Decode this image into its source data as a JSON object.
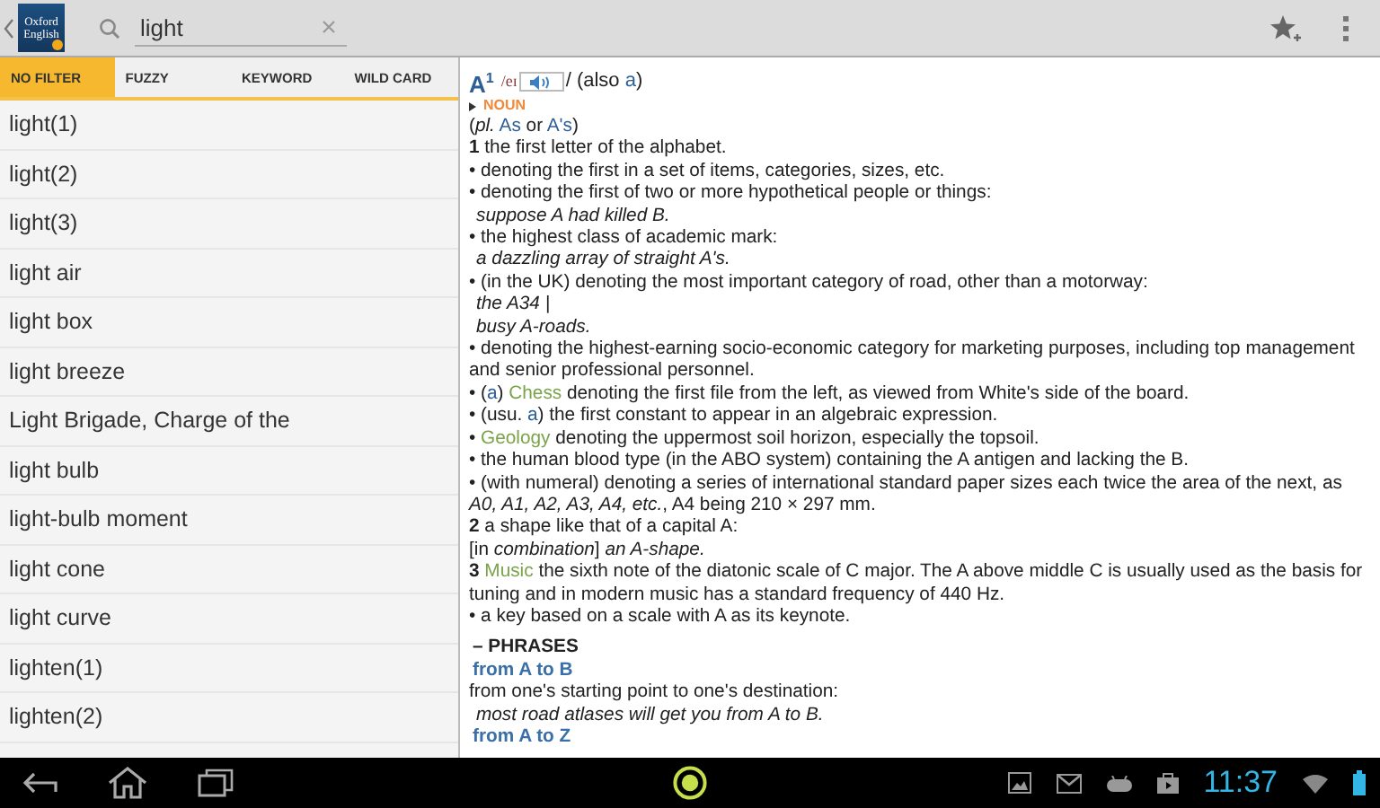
{
  "app_logo": {
    "lines": [
      "Oxford",
      "English"
    ]
  },
  "search": {
    "value": "light"
  },
  "filters": [
    {
      "label": "NO FILTER",
      "selected": true
    },
    {
      "label": "FUZZY",
      "selected": false
    },
    {
      "label": "KEYWORD",
      "selected": false
    },
    {
      "label": "WILD CARD",
      "selected": false
    }
  ],
  "results": [
    {
      "label": "light(1)"
    },
    {
      "label": "light(2)"
    },
    {
      "label": "light(3)"
    },
    {
      "label": "light air"
    },
    {
      "label": "light box"
    },
    {
      "label": "light breeze"
    },
    {
      "label": "Light Brigade, Charge of the"
    },
    {
      "label": "light bulb"
    },
    {
      "label": "light-bulb moment"
    },
    {
      "label": "light cone"
    },
    {
      "label": "light curve"
    },
    {
      "label": "lighten(1)"
    },
    {
      "label": "lighten(2)"
    }
  ],
  "entry": {
    "headword": "A",
    "homograph": "1",
    "pron_before": "/eɪ",
    "pron_after": "/ (also",
    "also": "a",
    "after_also": ")",
    "pos": "NOUN",
    "lines": [
      {
        "kind": "sense",
        "parts": [
          {
            "text": "(*pl.* ",
            "kind": "plain"
          },
          {
            "text": "As",
            "kind": "ref"
          },
          {
            "text": " or ",
            "kind": "plain"
          },
          {
            "text": "A's",
            "kind": "ref"
          },
          {
            "text": ")",
            "kind": "plain"
          }
        ]
      },
      {
        "kind": "sense",
        "parts": [
          {
            "text": "**1** the first letter of the alphabet.",
            "kind": "plain"
          }
        ]
      },
      {
        "kind": "sense",
        "parts": [
          {
            "text": "• denoting the first in a set of items, categories, sizes, etc.",
            "kind": "plain"
          }
        ]
      },
      {
        "kind": "sense",
        "parts": [
          {
            "text": "• denoting the first of two or more hypothetical people or things:",
            "kind": "plain"
          }
        ]
      },
      {
        "kind": "example",
        "parts": [
          {
            "text": "suppose A had killed B.",
            "kind": "plain"
          }
        ]
      },
      {
        "kind": "sense",
        "parts": [
          {
            "text": "• the highest class of academic mark:",
            "kind": "plain"
          }
        ]
      },
      {
        "kind": "example",
        "parts": [
          {
            "text": "a dazzling array of straight A's.",
            "kind": "plain"
          }
        ]
      },
      {
        "kind": "sense",
        "parts": [
          {
            "text": "• (in the UK) denoting the most important category of road, other than a motorway:",
            "kind": "plain"
          }
        ]
      },
      {
        "kind": "example",
        "parts": [
          {
            "text": "the A34 |",
            "kind": "plain"
          }
        ]
      },
      {
        "kind": "example",
        "parts": [
          {
            "text": "busy A-roads.",
            "kind": "plain"
          }
        ]
      },
      {
        "kind": "sense",
        "parts": [
          {
            "text": "• denoting the highest-earning socio-economic category for marketing purposes, including top management and senior professional personnel.",
            "kind": "plain"
          }
        ]
      },
      {
        "kind": "sense",
        "parts": [
          {
            "text": "• (",
            "kind": "plain"
          },
          {
            "text": "a",
            "kind": "ref"
          },
          {
            "text": ") ",
            "kind": "plain"
          },
          {
            "text": "Chess",
            "kind": "domain"
          },
          {
            "text": " denoting the first file from the left, as viewed from White's side of the board.",
            "kind": "plain"
          }
        ]
      },
      {
        "kind": "sense",
        "parts": [
          {
            "text": "• (usu. ",
            "kind": "plain"
          },
          {
            "text": "a",
            "kind": "ref"
          },
          {
            "text": ") the first constant to appear in an algebraic expression.",
            "kind": "plain"
          }
        ]
      },
      {
        "kind": "sense",
        "parts": [
          {
            "text": "• ",
            "kind": "plain"
          },
          {
            "text": "Geology",
            "kind": "domain"
          },
          {
            "text": " denoting the uppermost soil horizon, especially the topsoil.",
            "kind": "plain"
          }
        ]
      },
      {
        "kind": "sense",
        "parts": [
          {
            "text": "• the human blood type (in the ABO system) containing the A antigen and lacking the B.",
            "kind": "plain"
          }
        ]
      },
      {
        "kind": "sense",
        "parts": [
          {
            "text": "• (with numeral) denoting a series of international standard paper sizes each twice the area of the next, as *A0, A1, A2, A3, A4, etc.*, A4 being 210 × 297 mm.",
            "kind": "plain"
          }
        ]
      },
      {
        "kind": "sense",
        "parts": [
          {
            "text": "**2** a shape like that of a capital A:",
            "kind": "plain"
          }
        ]
      },
      {
        "kind": "sense",
        "parts": [
          {
            "text": "[in *combination*] *an A-shape.*",
            "kind": "plain"
          }
        ]
      },
      {
        "kind": "sense",
        "parts": [
          {
            "text": "**3** ",
            "kind": "plain"
          },
          {
            "text": "Music",
            "kind": "domain"
          },
          {
            "text": " the sixth note of the diatonic scale of C major. The A above middle C is usually used as the basis for tuning and in modern music has a standard frequency of 440 Hz.",
            "kind": "plain"
          }
        ]
      },
      {
        "kind": "sense",
        "parts": [
          {
            "text": "• a key based on a scale with A as its keynote.",
            "kind": "plain"
          }
        ]
      },
      {
        "kind": "heading",
        "parts": [
          {
            "text": "– PHRASES",
            "kind": "plain"
          }
        ]
      },
      {
        "kind": "phrase",
        "parts": [
          {
            "text": "from A to B",
            "kind": "plain"
          }
        ]
      },
      {
        "kind": "sense",
        "parts": [
          {
            "text": "from one's starting point to one's destination:",
            "kind": "plain"
          }
        ]
      },
      {
        "kind": "example",
        "parts": [
          {
            "text": "most road atlases will get you from A to B.",
            "kind": "plain"
          }
        ]
      },
      {
        "kind": "phrase",
        "parts": [
          {
            "text": "from A to Z",
            "kind": "plain"
          }
        ]
      }
    ]
  },
  "status_bar": {
    "time": "11:37"
  }
}
